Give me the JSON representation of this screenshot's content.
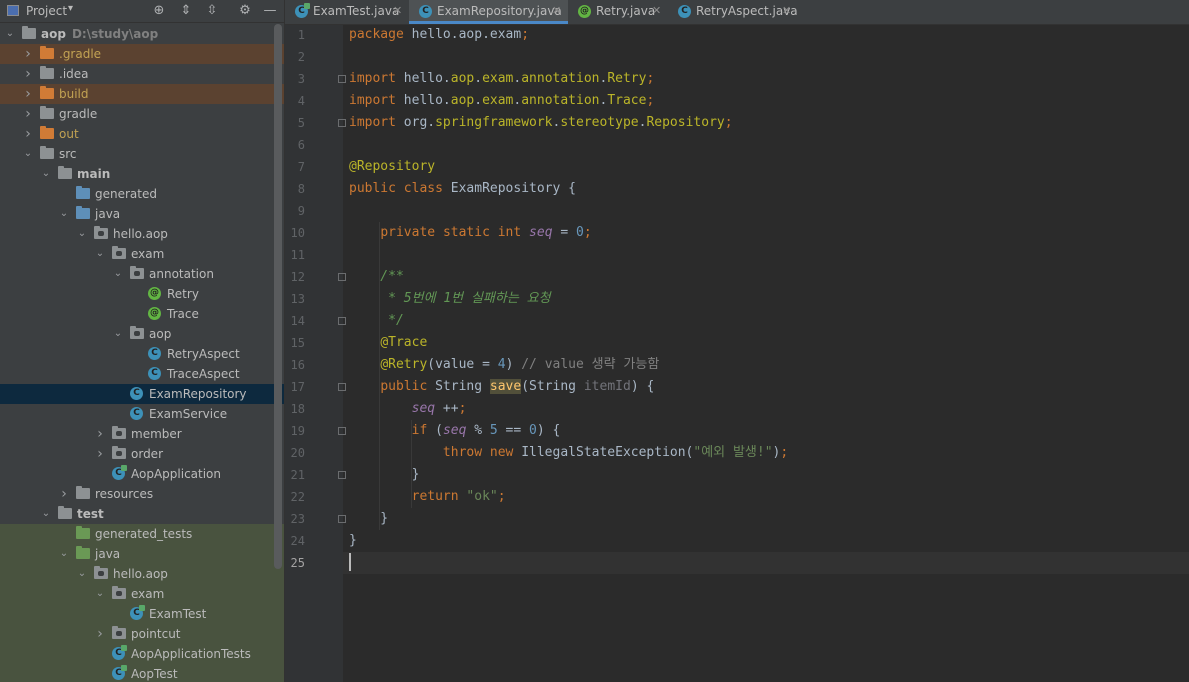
{
  "project_panel": {
    "title": "Project",
    "dropdown": "▾",
    "tree": [
      {
        "label": "aop",
        "path": "D:\\study\\aop",
        "depth": 0,
        "expanded": true,
        "icon": "folder",
        "bold": true
      },
      {
        "label": ".gradle",
        "depth": 1,
        "expanded": false,
        "icon": "folder-orange",
        "style": "excluded"
      },
      {
        "label": ".idea",
        "depth": 1,
        "expanded": false,
        "icon": "folder"
      },
      {
        "label": "build",
        "depth": 1,
        "expanded": false,
        "icon": "folder-orange",
        "style": "excluded"
      },
      {
        "label": "gradle",
        "depth": 1,
        "expanded": false,
        "icon": "folder"
      },
      {
        "label": "out",
        "depth": 1,
        "expanded": false,
        "icon": "folder-orange"
      },
      {
        "label": "src",
        "depth": 1,
        "expanded": true,
        "icon": "folder"
      },
      {
        "label": "main",
        "depth": 2,
        "expanded": true,
        "icon": "folder",
        "bold": true
      },
      {
        "label": "generated",
        "depth": 3,
        "icon": "folder-src"
      },
      {
        "label": "java",
        "depth": 3,
        "expanded": true,
        "icon": "folder-src"
      },
      {
        "label": "hello.aop",
        "depth": 4,
        "expanded": true,
        "icon": "package"
      },
      {
        "label": "exam",
        "depth": 5,
        "expanded": true,
        "icon": "package"
      },
      {
        "label": "annotation",
        "depth": 6,
        "expanded": true,
        "icon": "package"
      },
      {
        "label": "Retry",
        "depth": 7,
        "icon": "annotation"
      },
      {
        "label": "Trace",
        "depth": 7,
        "icon": "annotation"
      },
      {
        "label": "aop",
        "depth": 6,
        "expanded": true,
        "icon": "package"
      },
      {
        "label": "RetryAspect",
        "depth": 7,
        "icon": "class"
      },
      {
        "label": "TraceAspect",
        "depth": 7,
        "icon": "class"
      },
      {
        "label": "ExamRepository",
        "depth": 6,
        "icon": "class",
        "selected": true
      },
      {
        "label": "ExamService",
        "depth": 6,
        "icon": "class"
      },
      {
        "label": "member",
        "depth": 5,
        "expanded": false,
        "icon": "package"
      },
      {
        "label": "order",
        "depth": 5,
        "expanded": false,
        "icon": "package"
      },
      {
        "label": "AopApplication",
        "depth": 5,
        "icon": "class-run"
      },
      {
        "label": "resources",
        "depth": 3,
        "expanded": false,
        "icon": "folder"
      },
      {
        "label": "test",
        "depth": 2,
        "expanded": true,
        "icon": "folder",
        "bold": true
      },
      {
        "label": "generated_tests",
        "depth": 3,
        "icon": "folder-test",
        "style": "test"
      },
      {
        "label": "java",
        "depth": 3,
        "expanded": true,
        "icon": "folder-test",
        "style": "test"
      },
      {
        "label": "hello.aop",
        "depth": 4,
        "expanded": true,
        "icon": "package",
        "style": "test"
      },
      {
        "label": "exam",
        "depth": 5,
        "expanded": true,
        "icon": "package",
        "style": "test"
      },
      {
        "label": "ExamTest",
        "depth": 6,
        "icon": "class-run",
        "style": "test"
      },
      {
        "label": "pointcut",
        "depth": 5,
        "expanded": false,
        "icon": "package",
        "style": "test"
      },
      {
        "label": "AopApplicationTests",
        "depth": 5,
        "icon": "class-run",
        "style": "test"
      },
      {
        "label": "AopTest",
        "depth": 5,
        "icon": "class-run",
        "style": "test"
      }
    ]
  },
  "tabs": [
    {
      "label": "ExamTest.java",
      "icon": "class-run",
      "active": false
    },
    {
      "label": "ExamRepository.java",
      "icon": "class",
      "active": true
    },
    {
      "label": "Retry.java",
      "icon": "annotation",
      "active": false
    },
    {
      "label": "RetryAspect.java",
      "icon": "class",
      "active": false
    }
  ],
  "editor": {
    "current_line": 25,
    "lines": [
      "package hello.aop.exam;",
      "",
      "import hello.aop.exam.annotation.Retry;",
      "import hello.aop.exam.annotation.Trace;",
      "import org.springframework.stereotype.Repository;",
      "",
      "@Repository",
      "public class ExamRepository {",
      "",
      "    private static int seq = 0;",
      "",
      "    /**",
      "     * 5번에 1번 실패하는 요청",
      "     */",
      "    @Trace",
      "    @Retry(value = 4) // value 생략 가능함",
      "    public String save(String itemId) {",
      "        seq ++;",
      "        if (seq % 5 == 0) {",
      "            throw new IllegalStateException(\"예외 발생!\");",
      "        }",
      "        return \"ok\";",
      "    }",
      "}",
      ""
    ]
  }
}
